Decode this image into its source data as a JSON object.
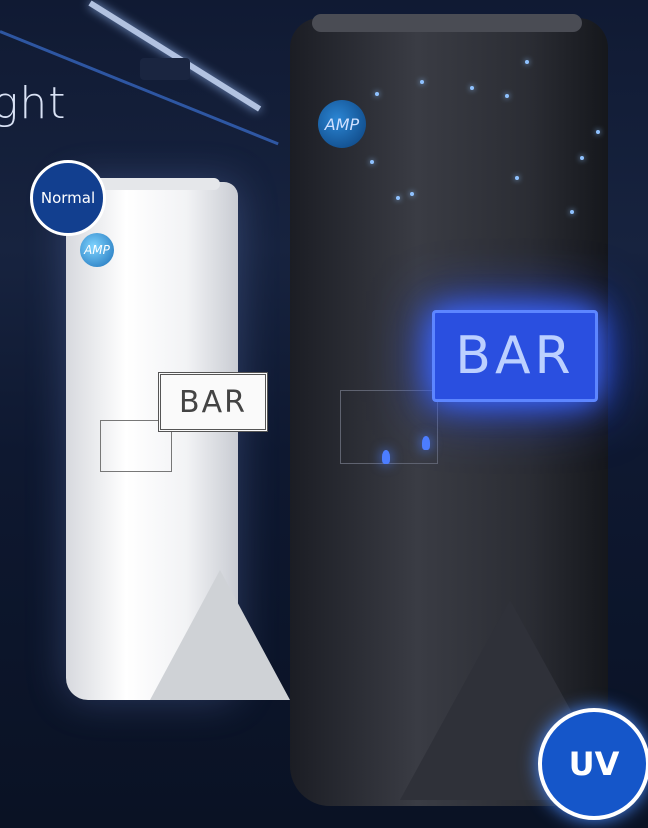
{
  "headline": "ght",
  "badges": {
    "normal": "Normal",
    "uv": "UV"
  },
  "cans": {
    "normal": {
      "logo": "AMP",
      "sign": "BAR"
    },
    "uv": {
      "logo": "AMP",
      "sign": "BAR"
    }
  },
  "colors": {
    "background": "#101a33",
    "uv_glow": "#3f6bff",
    "badge_blue": "#1556c9",
    "normal_badge_blue": "#123f8f"
  }
}
